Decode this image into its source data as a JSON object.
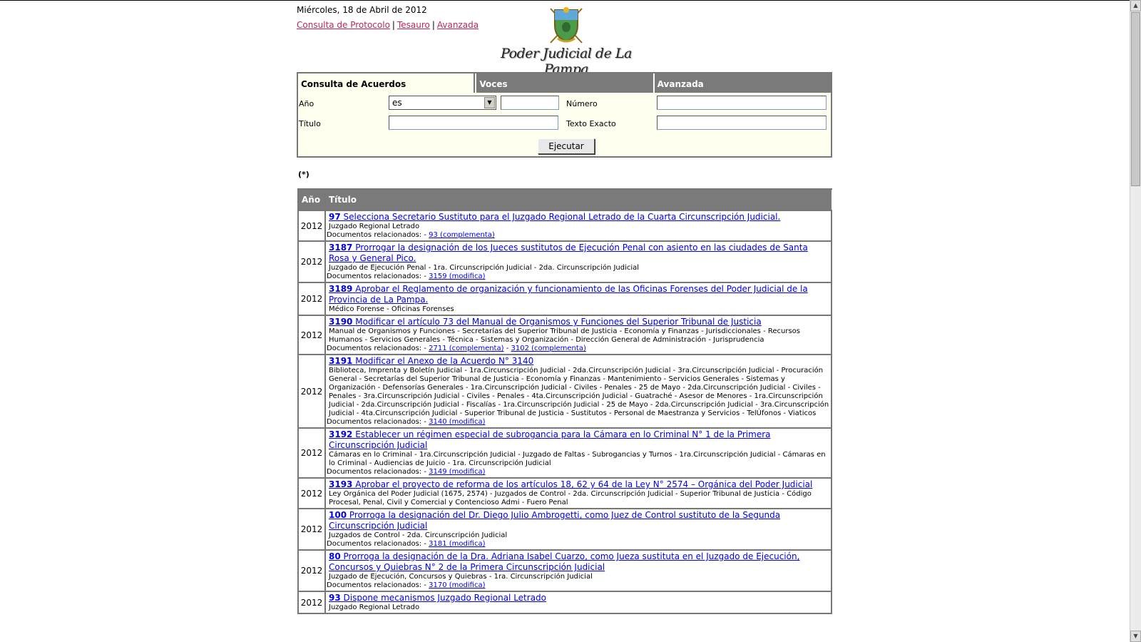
{
  "header": {
    "date": "Miércoles, 18 de Abril de 2012",
    "links": [
      "Consulta de Protocolo",
      "Tesauro",
      "Avanzada"
    ],
    "separator": "|",
    "brand": "Poder Judicial de La Pampa"
  },
  "search": {
    "tabs": [
      "Consulta de Acuerdos",
      "Voces",
      "Avanzada"
    ],
    "labels": {
      "anio": "Año",
      "numero": "Número",
      "titulo": "Título",
      "texto_exacto": "Texto Exacto"
    },
    "anio_select": "es",
    "submit": "Ejecutar"
  },
  "note": "(*)",
  "table": {
    "headers": [
      "Año",
      "Título"
    ],
    "rel_prefix": "Documentos relacionados: -",
    "rows": [
      {
        "year": "2012",
        "num": "97",
        "title": "Selecciona Secretario Sustituto para el Juzgado Regional Letrado de la Cuarta Circunscripción Judicial.",
        "tags": "Juzgado Regional Letrado",
        "rel": [
          "93 (complementa)"
        ]
      },
      {
        "year": "2012",
        "num": "3187",
        "title": "Prorrogar la designación de los Jueces sustitutos de Ejecución Penal con asiento en las ciudades de Santa Rosa y General Pico.",
        "tags": "Juzgado de Ejecución Penal - 1ra. Circunscripción Judicial - 2da. Circunscripción Judicial",
        "rel": [
          "3159 (modifica)"
        ]
      },
      {
        "year": "2012",
        "num": "3189",
        "title": "Aprobar el Reglamento de organización y funcionamiento de las Oficinas Forenses del Poder Judicial de la Provincia de La Pampa.",
        "tags": "Médico Forense - Oficinas Forenses",
        "rel": []
      },
      {
        "year": "2012",
        "num": "3190",
        "title": "Modificar el artículo 73 del Manual de Organismos y Funciones del Superior Tribunal de Justicia",
        "tags": "Manual de Organismos y Funciones - Secretarías del Superior Tribunal de Justicia - Economía y Finanzas - Jurisdiccionales - Recursos Humanos - Servicios Generales - Técnica - Sistemas y Organización - Dirección General de Administración - Jurisprudencia",
        "rel": [
          "2711 (complementa)",
          "3102 (complementa)"
        ]
      },
      {
        "year": "2012",
        "num": "3191",
        "title": "Modificar el Anexo de la Acuerdo N° 3140",
        "tags": "Biblioteca, Imprenta y Boletín Judicial - 1ra.Circunscripción Judicial - 2da.Circunscripción Judicial - 3ra.Circunscripción Judicial - Procuración General - Secretarías del Superior Tribunal de Justicia - Economía y Finanzas - Mantenimiento - Servicios Generales - Sistemas y Organización - Defensorías Generales - 1ra.Circunscripción Judicial - Civiles - Penales - 25 de Mayo - 2da.Circunscripción Judicial - Civiles - Penales - 3ra.Circunscripción Judicial - Civiles - Penales - 4ta.Circunscripción Judicial - Guatraché - Asesor de Menores - 1ra.Circunscripción Judicial - 2da.Circunscripción Judicial - Fiscalías - 1ra.Circunscripción Judicial - 25 de Mayo - 2da.Circunscripción Judicial - 3ra.Circunscripción Judicial - 4ta.Circunscripción Judicial - Superior Tribunal de Justicia - Sustitutos - Personal de Maestranza y Servicios - TelÚfonos - Viaticos",
        "rel": [
          "3140 (modifica)"
        ]
      },
      {
        "year": "2012",
        "num": "3192",
        "title": "Establecer un régimen especial de subrogancia para la Cámara en lo Criminal N° 1 de la Primera Circunscripción Judicial",
        "tags": "Cámaras en lo Criminal - 1ra.Circunscripción Judicial - Juzgado de Faltas - Subrogancias y Turnos - 1ra.Circunscripción Judicial - Cámaras en lo Criminal - Audiencias de Juicio - 1ra. Circunscripción Judicial",
        "rel": [
          "3149 (modifica)"
        ]
      },
      {
        "year": "2012",
        "num": "3193",
        "title": "Aprobar el proyecto de reforma de los artículos 18, 62 y 64 de la Ley N° 2574 – Orgánica del Poder Judicial",
        "tags": "Ley Orgánica del Poder Judicial (1675, 2574) - Juzgados de Control - 2da. Circunscripción Judicial - Superior Tribunal de Justicia - Código Procesal, Penal, Civil y Comercial y Contencioso Admi - Fuero Penal",
        "rel": []
      },
      {
        "year": "2012",
        "num": "100",
        "title": "Prorroga la designación del Dr. Diego Julio Ambrogetti, como Juez de Control sustituto de la Segunda Circunscripción Judicial",
        "tags": "Juzgados de Control - 2da. Circunscripción Judicial",
        "rel": [
          "3181 (modifica)"
        ]
      },
      {
        "year": "2012",
        "num": "80",
        "title": "Prorroga la designación de la Dra. Adriana Isabel Cuarzo, como Jueza sustituta en el Juzgado de Ejecución, Concursos y Quiebras N° 2 de la Primera Circunscripción Judicial",
        "tags": "Juzgado de Ejecución, Concursos y Quiebras - 1ra. Circunscripción Judicial",
        "rel": [
          "3170 (modifica)"
        ]
      },
      {
        "year": "2012",
        "num": "93",
        "title": "Dispone mecanismos Juzgado Regional Letrado",
        "tags": "Juzgado Regional Letrado",
        "rel": []
      }
    ]
  }
}
